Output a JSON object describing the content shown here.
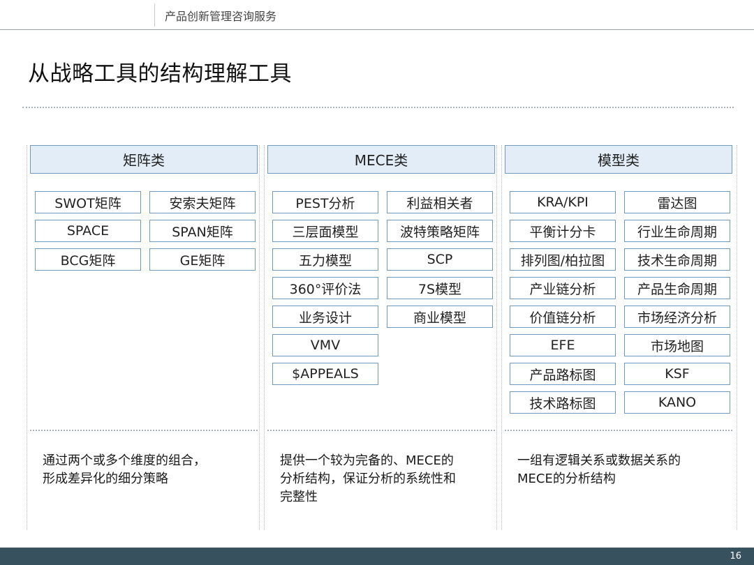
{
  "header": {
    "text": "产品创新管理咨询服务"
  },
  "title": "从战略工具的结构理解工具",
  "columns": [
    {
      "heading": "矩阵类",
      "left": [
        "SWOT矩阵",
        "SPACE",
        "BCG矩阵"
      ],
      "right": [
        "安索夫矩阵",
        "SPAN矩阵",
        "GE矩阵"
      ],
      "description": [
        "通过两个或多个维度的组合，",
        "形成差异化的细分策略"
      ]
    },
    {
      "heading": "MECE类",
      "left": [
        "PEST分析",
        "三层面模型",
        "五力模型",
        "360°评价法",
        "业务设计",
        "VMV",
        "$APPEALS"
      ],
      "right": [
        "利益相关者",
        "波特策略矩阵",
        "SCP",
        "7S模型",
        "商业模型"
      ],
      "description": [
        "提供一个较为完备的、MECE的",
        "分析结构，保证分析的系统性和",
        "完整性"
      ]
    },
    {
      "heading": "模型类",
      "left": [
        "KRA/KPI",
        "平衡计分卡",
        "排列图/柏拉图",
        "产业链分析",
        "价值链分析",
        "EFE",
        "产品路标图",
        "技术路标图"
      ],
      "right": [
        "雷达图",
        "行业生命周期",
        "技术生命周期",
        "产品生命周期",
        "市场经济分析",
        "市场地图",
        "KSF",
        "KANO"
      ],
      "description": [
        "一组有逻辑关系或数据关系的",
        "MECE的分析结构"
      ]
    }
  ],
  "footer": {
    "page_number": "16"
  },
  "colors": {
    "box_border": "#6f9ac2",
    "head_fill": "#e3edf7",
    "footer_bar": "#37515f"
  }
}
